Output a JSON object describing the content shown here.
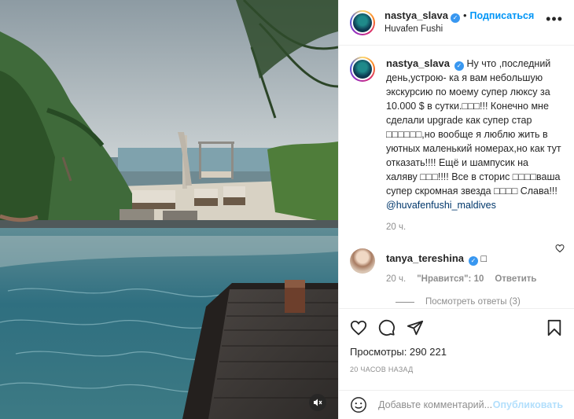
{
  "post": {
    "author": "nastya_slava",
    "follow_label": "Подписаться",
    "location": "Huvafen Fushi",
    "more_label": "•••",
    "caption_text": "Ну что ,последний день,устрою- ка я вам небольшую экскурсию по моему супер люксу за 10.000 $ в сутки.□□□!!! Конечно мне сделали upgrade как супер стар □□□□□□,но вообще я люблю жить в уютных маленький номерах,но как тут отказать!!!! Ещё и шампусик на халяву □□□!!!! Все в сторис □□□□ваша супер скромная звезда □□□□ Слава!!!",
    "caption_mention": "@huvafenfushi_maldives",
    "caption_age": "20 ч."
  },
  "comment": {
    "author": "tanya_tereshina",
    "text": "□",
    "age": "20 ч.",
    "likes": "\"Нравится\": 10",
    "reply_label": "Ответить",
    "view_replies": "Посмотреть ответы (3)"
  },
  "stats": {
    "views": "Просмотры: 290 221",
    "timestamp": "20 ЧАСОВ НАЗАД"
  },
  "composer": {
    "placeholder": "Добавьте комментарий...",
    "publish_label": "Опубликовать"
  },
  "icons": {
    "verified": "verified-badge-icon",
    "like": "heart-icon",
    "comment": "comment-icon",
    "share": "share-icon",
    "save": "bookmark-icon",
    "emoji": "emoji-icon",
    "mute": "speaker-muted-icon"
  },
  "colors": {
    "accent": "#0095f6",
    "verified": "#3897f0",
    "muted_text": "#8e8e8e",
    "mention": "#00376b"
  }
}
